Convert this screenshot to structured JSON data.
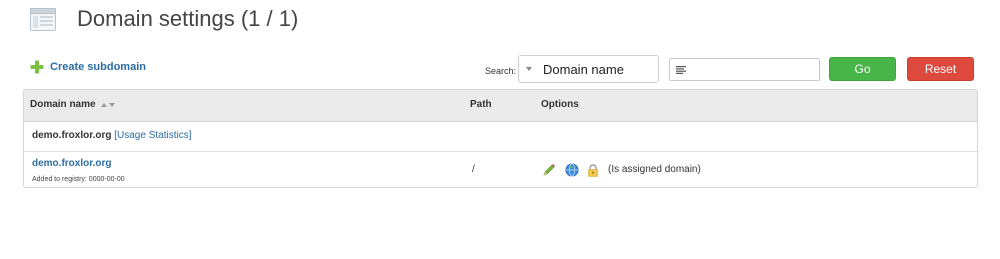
{
  "header": {
    "title": "Domain settings (1 / 1)",
    "icon": "page-window-icon"
  },
  "toolbar": {
    "create_subdomain_label": "Create subdomain",
    "create_icon": "plus-icon",
    "search_label": "Search:",
    "search_field_selected": "Domain name",
    "search_value": "",
    "go_label": "Go",
    "reset_label": "Reset"
  },
  "colors": {
    "accent_link": "#2d6ca2",
    "go_button": "#47b547",
    "reset_button": "#dd4a3d",
    "header_bg": "#ebebeb"
  },
  "table": {
    "columns": [
      "Domain name",
      "Path",
      "Options"
    ],
    "group_row": {
      "domain": "demo.froxlor.org",
      "stats_link": "[Usage Statistics]"
    },
    "rows": [
      {
        "domain": "demo.froxlor.org",
        "added": "Added to registry: 0000-00-00",
        "path": "/",
        "option_icons": [
          "edit-pencil-icon",
          "globe-icon",
          "lock-icon"
        ],
        "note": "(Is assigned domain)"
      }
    ]
  }
}
